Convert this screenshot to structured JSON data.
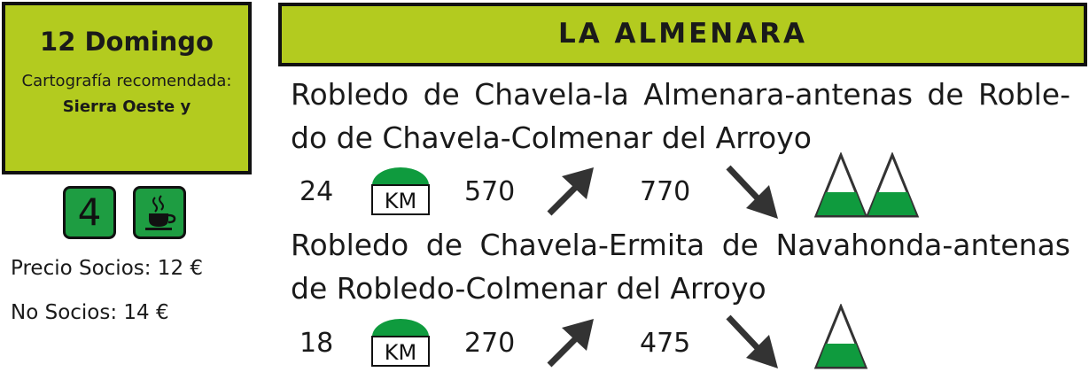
{
  "date_box": {
    "title": "12 Domingo",
    "cartography_label": "Cartografía recomendada:",
    "cartography_value": "Sierra Oeste y"
  },
  "badges": {
    "level": "4",
    "cafe_icon": "coffee-cup-icon"
  },
  "prices": {
    "socios": "Precio Socios: 12 €",
    "no_socios": "No Socios: 14 €"
  },
  "header": {
    "title": "LA ALMENARA"
  },
  "colors": {
    "header_bg": "#b3cb1f",
    "badge_green": "#1e9d42",
    "mountain_green": "#0f9b3e",
    "arrow": "#333333"
  },
  "routes": [
    {
      "name": "Robledo de Chavela-la Almenara-antenas de Roble-do de Chavela-Colmenar del Arroyo",
      "distance": "24",
      "distance_unit": "KM",
      "ascent": "570",
      "descent": "770",
      "difficulty_count": 2
    },
    {
      "name": "Robledo de Chavela-Ermita de Navahonda-antenas de Robledo-Colmenar del Arroyo",
      "distance": "18",
      "distance_unit": "KM",
      "ascent": "270",
      "descent": "475",
      "difficulty_count": 1
    }
  ]
}
